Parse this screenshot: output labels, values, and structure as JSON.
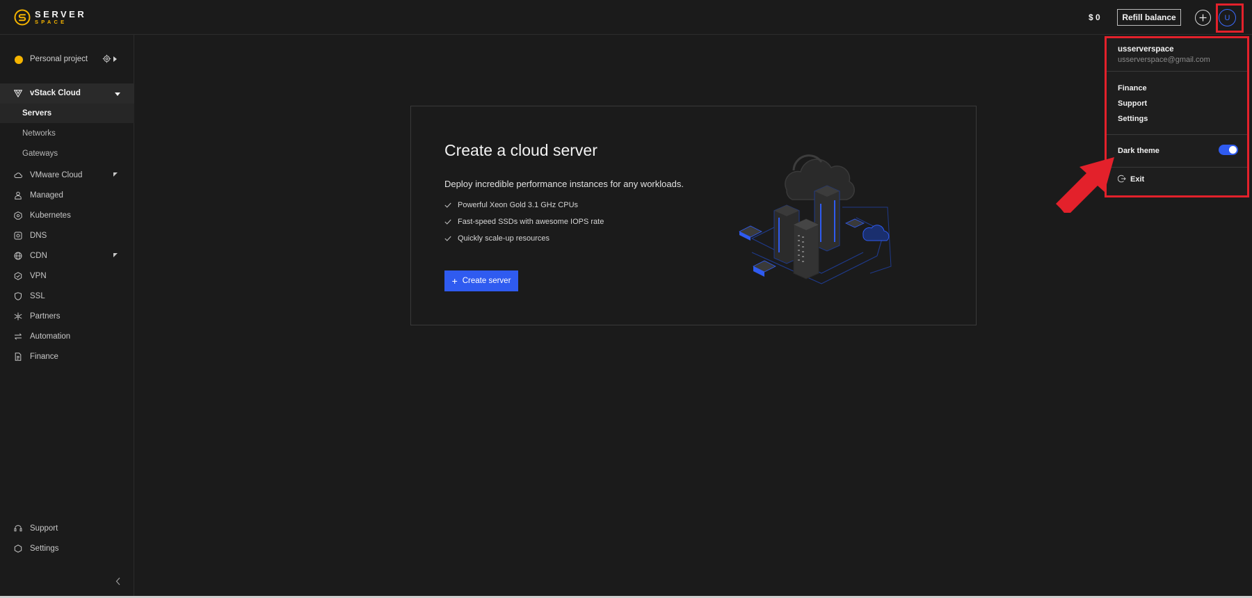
{
  "header": {
    "logo_top": "SERVER",
    "logo_bottom": "SPACE",
    "balance": "$ 0",
    "refill_label": "Refill balance",
    "avatar_letter": "U"
  },
  "sidebar": {
    "project_label": "Personal project",
    "section_label": "vStack Cloud",
    "sub_items": [
      {
        "label": "Servers",
        "active": true
      },
      {
        "label": "Networks"
      },
      {
        "label": "Gateways"
      }
    ],
    "items": [
      {
        "label": "VMware Cloud",
        "icon": "cloud-icon",
        "expandable": true
      },
      {
        "label": "Managed",
        "icon": "person-icon"
      },
      {
        "label": "Kubernetes",
        "icon": "kubernetes-icon"
      },
      {
        "label": "DNS",
        "icon": "dns-icon"
      },
      {
        "label": "CDN",
        "icon": "globe-icon",
        "expandable": true
      },
      {
        "label": "VPN",
        "icon": "vpn-icon"
      },
      {
        "label": "SSL",
        "icon": "shield-icon"
      },
      {
        "label": "Partners",
        "icon": "partners-icon"
      },
      {
        "label": "Automation",
        "icon": "automation-icon"
      },
      {
        "label": "Finance",
        "icon": "document-icon"
      }
    ],
    "bottom_items": [
      {
        "label": "Support",
        "icon": "headset-icon"
      },
      {
        "label": "Settings",
        "icon": "hexagon-icon"
      }
    ]
  },
  "main": {
    "title": "Create a cloud server",
    "lead": "Deploy incredible performance instances for any workloads.",
    "features": [
      "Powerful Xeon Gold 3.1 GHz CPUs",
      "Fast-speed SSDs with awesome IOPS rate",
      "Quickly scale-up resources"
    ],
    "button_label": "Create server"
  },
  "user_menu": {
    "username": "usserverspace",
    "email": "usserverspace@gmail.com",
    "items": [
      "Finance",
      "Support",
      "Settings"
    ],
    "dark_theme_label": "Dark theme",
    "dark_theme_on": true,
    "exit_label": "Exit"
  },
  "colors": {
    "accent": "#2f5bf0",
    "brand": "#f5b400",
    "highlight": "#e3212b",
    "background": "#1b1b1b"
  }
}
